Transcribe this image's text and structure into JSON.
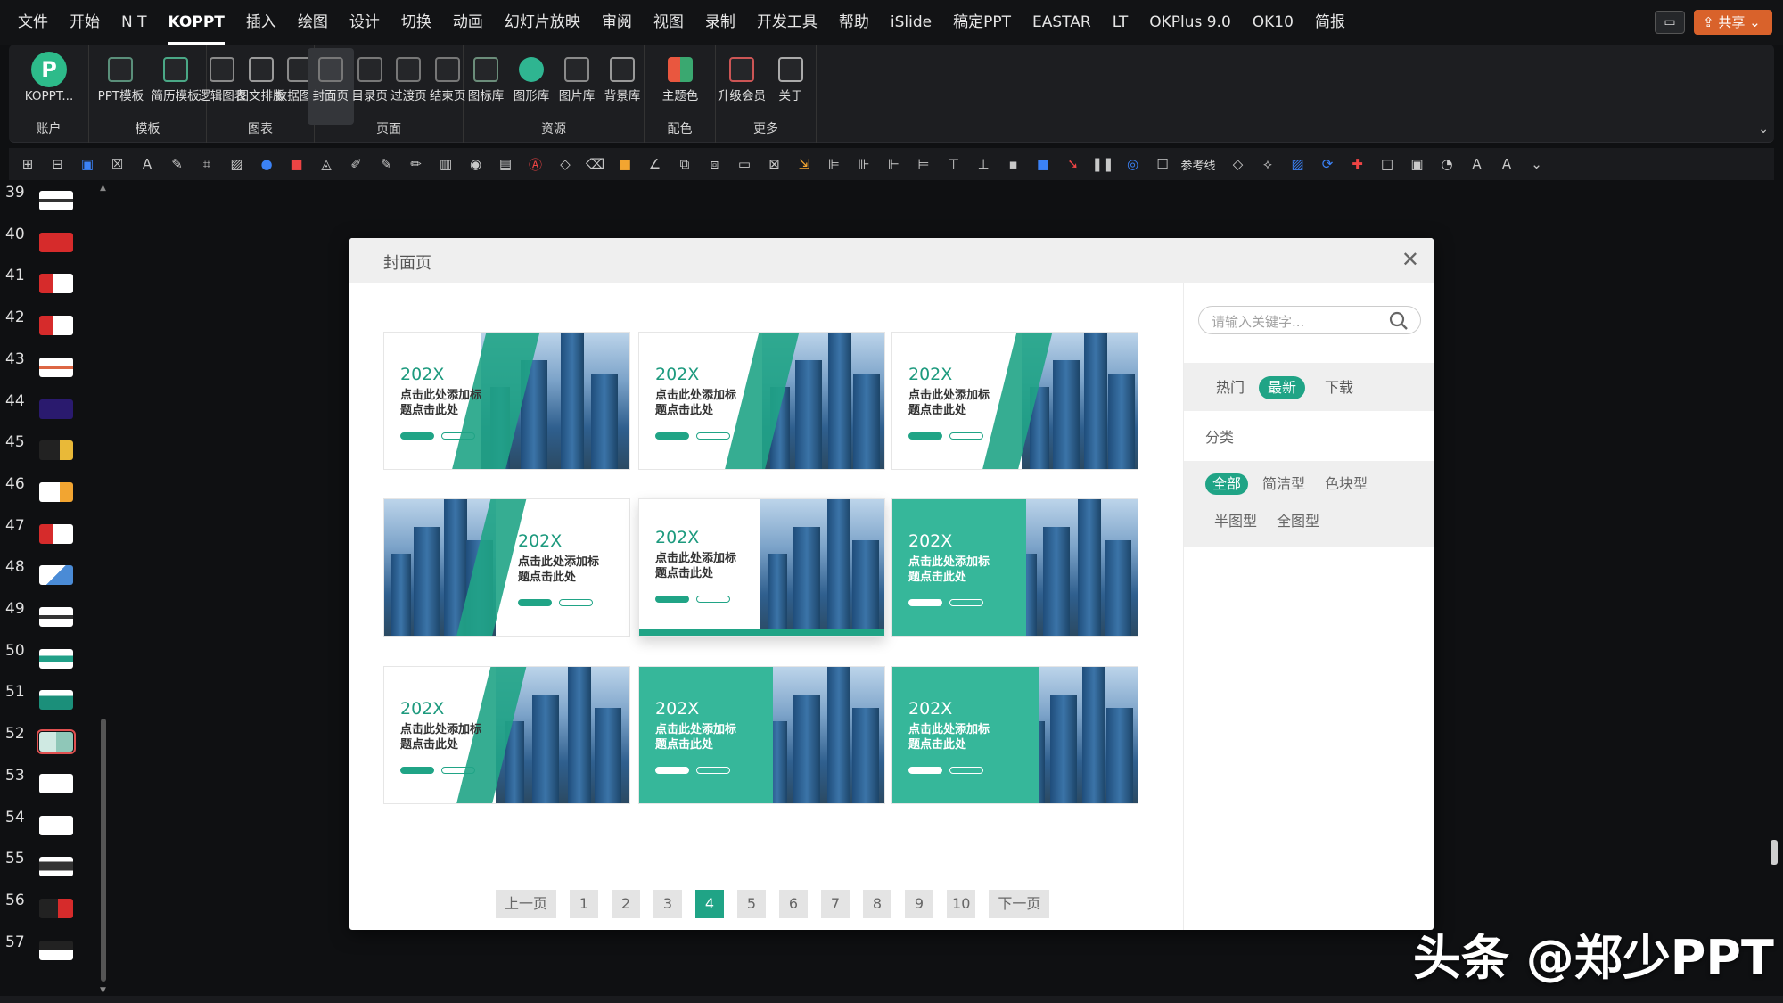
{
  "menu": [
    "文件",
    "开始",
    "N T",
    "KOPPT",
    "插入",
    "绘图",
    "设计",
    "切换",
    "动画",
    "幻灯片放映",
    "审阅",
    "视图",
    "录制",
    "开发工具",
    "帮助",
    "iSlide",
    "稿定PPT",
    "EASTAR",
    "LT",
    "OKPlus 9.0",
    "OK10",
    "简报"
  ],
  "menu_active": "KOPPT",
  "share_label": "共享",
  "ribbon": {
    "groups": [
      {
        "label": "账户",
        "buttons": [
          {
            "label": "KOPPT...",
            "icon": "koppt-logo-icon"
          }
        ]
      },
      {
        "label": "模板",
        "buttons": [
          {
            "label": "PPT模板",
            "icon": "ppt-template-icon"
          },
          {
            "label": "简历模板",
            "icon": "resume-template-icon"
          }
        ]
      },
      {
        "label": "图表",
        "buttons": [
          {
            "label": "逻辑图表",
            "icon": "logic-chart-icon"
          },
          {
            "label": "图文排版",
            "icon": "layout-icon"
          },
          {
            "label": "数据图表",
            "icon": "data-chart-icon"
          }
        ]
      },
      {
        "label": "页面",
        "buttons": [
          {
            "label": "封面页",
            "icon": "cover-page-icon"
          },
          {
            "label": "目录页",
            "icon": "toc-page-icon"
          },
          {
            "label": "过渡页",
            "icon": "transition-page-icon"
          },
          {
            "label": "结束页",
            "icon": "end-page-icon"
          }
        ]
      },
      {
        "label": "资源",
        "buttons": [
          {
            "label": "图标库",
            "icon": "icon-library-icon"
          },
          {
            "label": "图形库",
            "icon": "shape-library-icon"
          },
          {
            "label": "图片库",
            "icon": "image-library-icon"
          },
          {
            "label": "背景库",
            "icon": "background-library-icon"
          }
        ]
      },
      {
        "label": "配色",
        "buttons": [
          {
            "label": "主题色",
            "icon": "theme-color-icon"
          }
        ]
      },
      {
        "label": "更多",
        "buttons": [
          {
            "label": "升级会员",
            "icon": "upgrade-icon"
          },
          {
            "label": "关于",
            "icon": "info-icon"
          }
        ]
      }
    ]
  },
  "quick_toolbar": {
    "guide_label": "参考线"
  },
  "slides": [
    {
      "num": "39",
      "thumb": "white-black"
    },
    {
      "num": "40",
      "thumb": "red"
    },
    {
      "num": "41",
      "thumb": "red-white"
    },
    {
      "num": "42",
      "thumb": "red-white"
    },
    {
      "num": "43",
      "thumb": "white-red"
    },
    {
      "num": "44",
      "thumb": "purple"
    },
    {
      "num": "45",
      "thumb": "dark-yellow"
    },
    {
      "num": "46",
      "thumb": "white-orange"
    },
    {
      "num": "47",
      "thumb": "red-white"
    },
    {
      "num": "48",
      "thumb": "white-blue"
    },
    {
      "num": "49",
      "thumb": "white-black"
    },
    {
      "num": "50",
      "thumb": "teal-white"
    },
    {
      "num": "51",
      "thumb": "teal"
    },
    {
      "num": "52",
      "thumb": "teal-selected"
    },
    {
      "num": "53",
      "thumb": "white"
    },
    {
      "num": "54",
      "thumb": "white"
    },
    {
      "num": "55",
      "thumb": "white-dark"
    },
    {
      "num": "56",
      "thumb": "dark-red"
    },
    {
      "num": "57",
      "thumb": "dark-white"
    }
  ],
  "selected_slide": "52",
  "dialog": {
    "title": "封面页",
    "card_year": "202X",
    "card_title_line1": "点击此处添加标",
    "card_title_line2": "题点击此处",
    "search_placeholder": "请输入关键字...",
    "tabs": [
      "热门",
      "最新",
      "下载"
    ],
    "active_tab": "最新",
    "category_title": "分类",
    "categories": [
      "全部",
      "简洁型",
      "色块型",
      "半图型",
      "全图型"
    ],
    "active_category": "全部",
    "pager": {
      "prev": "上一页",
      "pages": [
        "1",
        "2",
        "3",
        "4",
        "5",
        "6",
        "7",
        "8",
        "9",
        "10"
      ],
      "current": "4",
      "next": "下一页"
    }
  },
  "watermark": "头条 @郑少PPT",
  "colors": {
    "accent": "#20a486",
    "share": "#d9622b",
    "selected_slide_outline": "#e05050"
  }
}
